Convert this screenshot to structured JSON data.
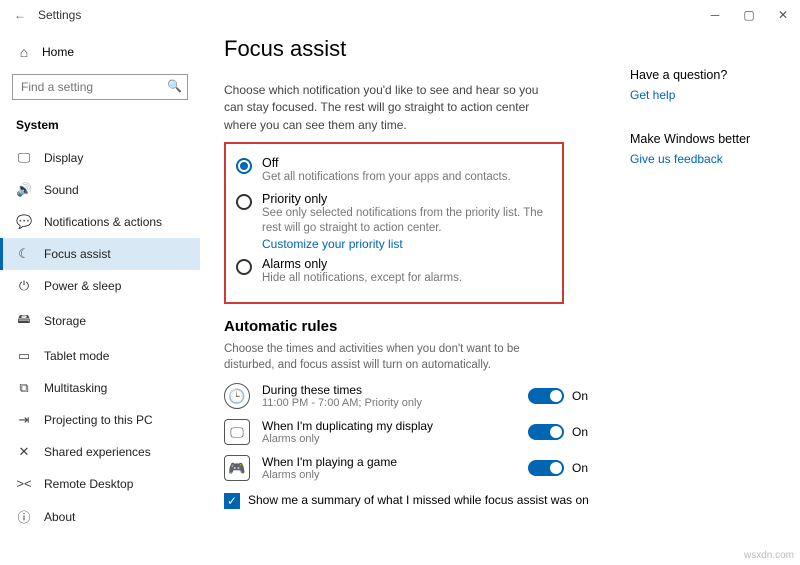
{
  "titlebar": {
    "back": "←",
    "title": "Settings"
  },
  "sidebar": {
    "home": "Home",
    "search_placeholder": "Find a setting",
    "category": "System",
    "items": [
      {
        "icon": "🖵",
        "label": "Display"
      },
      {
        "icon": "🔊",
        "label": "Sound"
      },
      {
        "icon": "💬",
        "label": "Notifications & actions"
      },
      {
        "icon": "☾",
        "label": "Focus assist"
      },
      {
        "icon": "⏻",
        "label": "Power & sleep"
      },
      {
        "icon": "🖴",
        "label": "Storage"
      },
      {
        "icon": "▭",
        "label": "Tablet mode"
      },
      {
        "icon": "⧉",
        "label": "Multitasking"
      },
      {
        "icon": "⇥",
        "label": "Projecting to this PC"
      },
      {
        "icon": "✕",
        "label": "Shared experiences"
      },
      {
        "icon": "><",
        "label": "Remote Desktop"
      },
      {
        "icon": "ⓘ",
        "label": "About"
      }
    ]
  },
  "main": {
    "heading": "Focus assist",
    "intro": "Choose which notification you'd like to see and hear so you can stay focused. The rest will go straight to action center where you can see them any time.",
    "radios": {
      "off": {
        "label": "Off",
        "desc": "Get all notifications from your apps and contacts."
      },
      "prio": {
        "label": "Priority only",
        "desc": "See only selected notifications from the priority list. The rest will go straight to action center.",
        "link": "Customize your priority list"
      },
      "alarm": {
        "label": "Alarms only",
        "desc": "Hide all notifications, except for alarms."
      }
    },
    "rules": {
      "heading": "Automatic rules",
      "intro": "Choose the times and activities when you don't want to be disturbed, and focus assist will turn on automatically.",
      "on_label": "On",
      "r1": {
        "title": "During these times",
        "sub": "11:00 PM - 7:00 AM; Priority only"
      },
      "r2": {
        "title": "When I'm duplicating my display",
        "sub": "Alarms only"
      },
      "r3": {
        "title": "When I'm playing a game",
        "sub": "Alarms only"
      }
    },
    "summary_check": "Show me a summary of what I missed while focus assist was on"
  },
  "aside": {
    "q_heading": "Have a question?",
    "q_link": "Get help",
    "f_heading": "Make Windows better",
    "f_link": "Give us feedback"
  },
  "watermark": "wsxdn.com"
}
